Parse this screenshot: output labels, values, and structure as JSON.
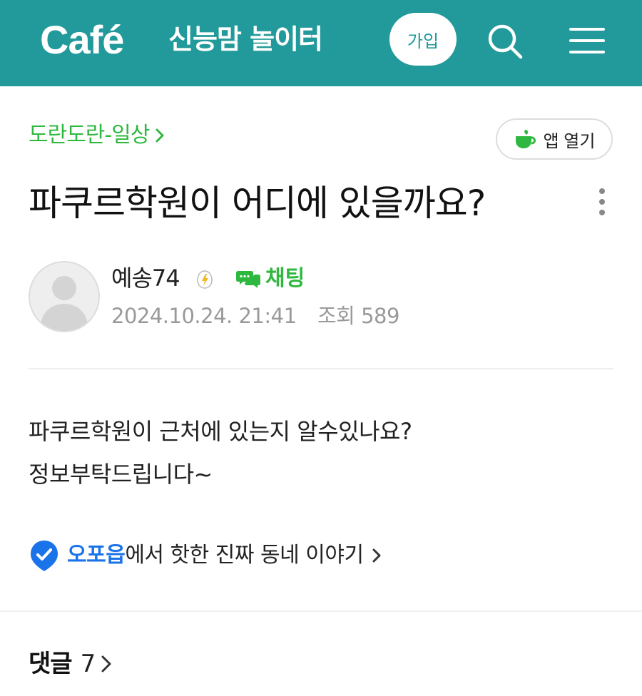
{
  "header": {
    "logo": "Café",
    "cafe_name": "신능맘 놀이터",
    "join_label": "가입",
    "accent_color": "#22999a",
    "search_icon": "search-icon",
    "menu_icon": "hamburger-menu-icon"
  },
  "board": {
    "name": "도란도란-일상",
    "chevron": "›"
  },
  "app_open": {
    "label": "앱 열기",
    "icon": "cup-icon"
  },
  "post": {
    "title": "파쿠르학원이 어디에 있을까요?",
    "author": "예송74",
    "chat_label": "채팅",
    "date": "2024.10.24. 21:41",
    "views_label": "조회",
    "views": "589",
    "body_lines": [
      "파쿠르학원이 근처에 있는지 알수있나요?",
      "정보부탁드립니다~"
    ]
  },
  "promo": {
    "brand": "오포읍",
    "text": "에서 핫한 진짜 동네 이야기",
    "chevron": "›",
    "brand_color": "#1a73e8"
  },
  "comments": {
    "label": "댓글",
    "count": "7",
    "chevron": "›"
  }
}
